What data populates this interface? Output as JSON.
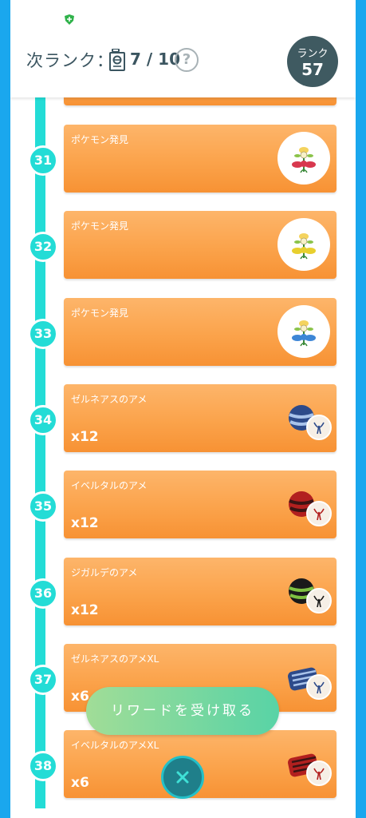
{
  "header": {
    "next_rank_label": "次ランク：",
    "progress": "7 / 10",
    "help_symbol": "?",
    "rank_label": "ランク",
    "rank_value": "57"
  },
  "rewards": [
    {
      "level": "31",
      "title": "ポケモン発見",
      "type": "pokemon",
      "icon": "flabebe-red-flower-icon"
    },
    {
      "level": "32",
      "title": "ポケモン発見",
      "type": "pokemon",
      "icon": "flabebe-yellow-flower-icon"
    },
    {
      "level": "33",
      "title": "ポケモン発見",
      "type": "pokemon",
      "icon": "flabebe-blue-flower-icon"
    },
    {
      "level": "34",
      "title": "ゼルネアスのアメ",
      "qty": "x12",
      "type": "candy",
      "icon": "xerneas-candy-icon",
      "color": "#2d4a8a",
      "stripe": "#a9c3ea"
    },
    {
      "level": "35",
      "title": "イベルタルのアメ",
      "qty": "x12",
      "type": "candy",
      "icon": "yveltal-candy-icon",
      "color": "#b2201f",
      "stripe": "#3b1414"
    },
    {
      "level": "36",
      "title": "ジガルデのアメ",
      "qty": "x12",
      "type": "candy",
      "icon": "zygarde-candy-icon",
      "color": "#1a1a1a",
      "stripe": "#7fc242"
    },
    {
      "level": "37",
      "title": "ゼルネアスのアメXL",
      "qty": "x6",
      "type": "candy-xl",
      "icon": "xerneas-candy-xl-icon",
      "color": "#2d4a8a",
      "stripe": "#a9c3ea"
    },
    {
      "level": "38",
      "title": "イベルタルのアメXL",
      "qty": "x6",
      "type": "candy-xl",
      "icon": "yveltal-candy-xl-icon",
      "color": "#b2201f",
      "stripe": "#3b1414"
    }
  ],
  "claim_button_label": "リワードを受け取る",
  "colors": {
    "timeline": "#23dcd6",
    "card_orange": "#fba34b",
    "rank_badge": "#3f5a61",
    "claim_green": "#58d3a6",
    "close_teal": "#1f7f8a"
  }
}
